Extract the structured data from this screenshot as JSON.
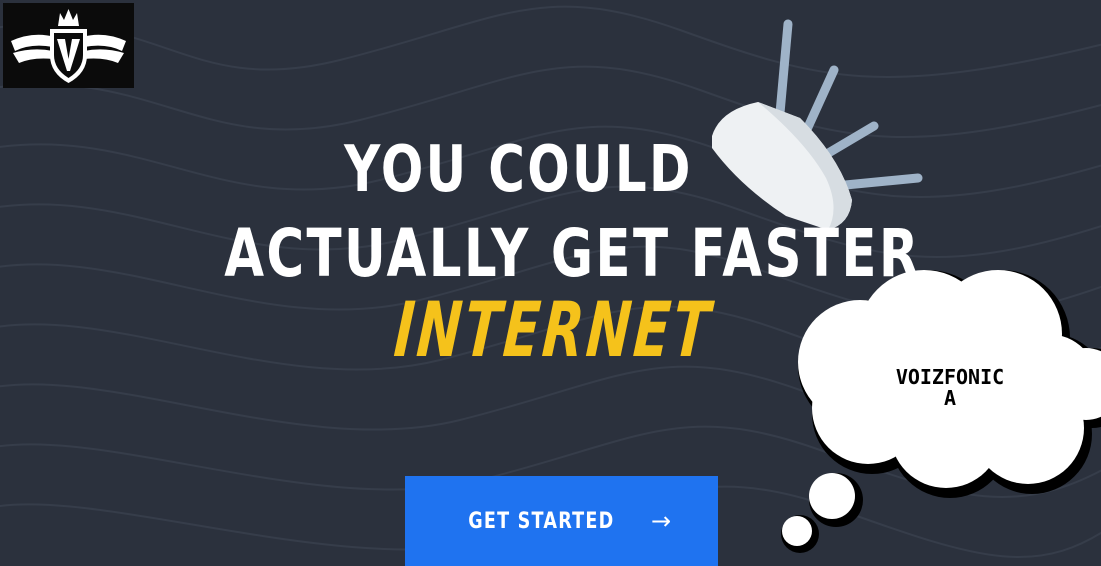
{
  "hero": {
    "headline_line1": "YOU COULD",
    "headline_line2": "ACTUALLY GET FASTER",
    "accent_word": "INTERNET"
  },
  "cta": {
    "label": "GET STARTED",
    "arrow": "→"
  },
  "bubble": {
    "text_line1": "VOIZFONIC",
    "text_line2": "A"
  },
  "icons": {
    "logo": "crowned-v-shield-logo",
    "product": "wifi-router-icon",
    "arrow": "arrow-right-icon"
  },
  "colors": {
    "background": "#2b313d",
    "accent_yellow": "#f5c21b",
    "cta_blue": "#1f73f0",
    "text_white": "#ffffff"
  }
}
